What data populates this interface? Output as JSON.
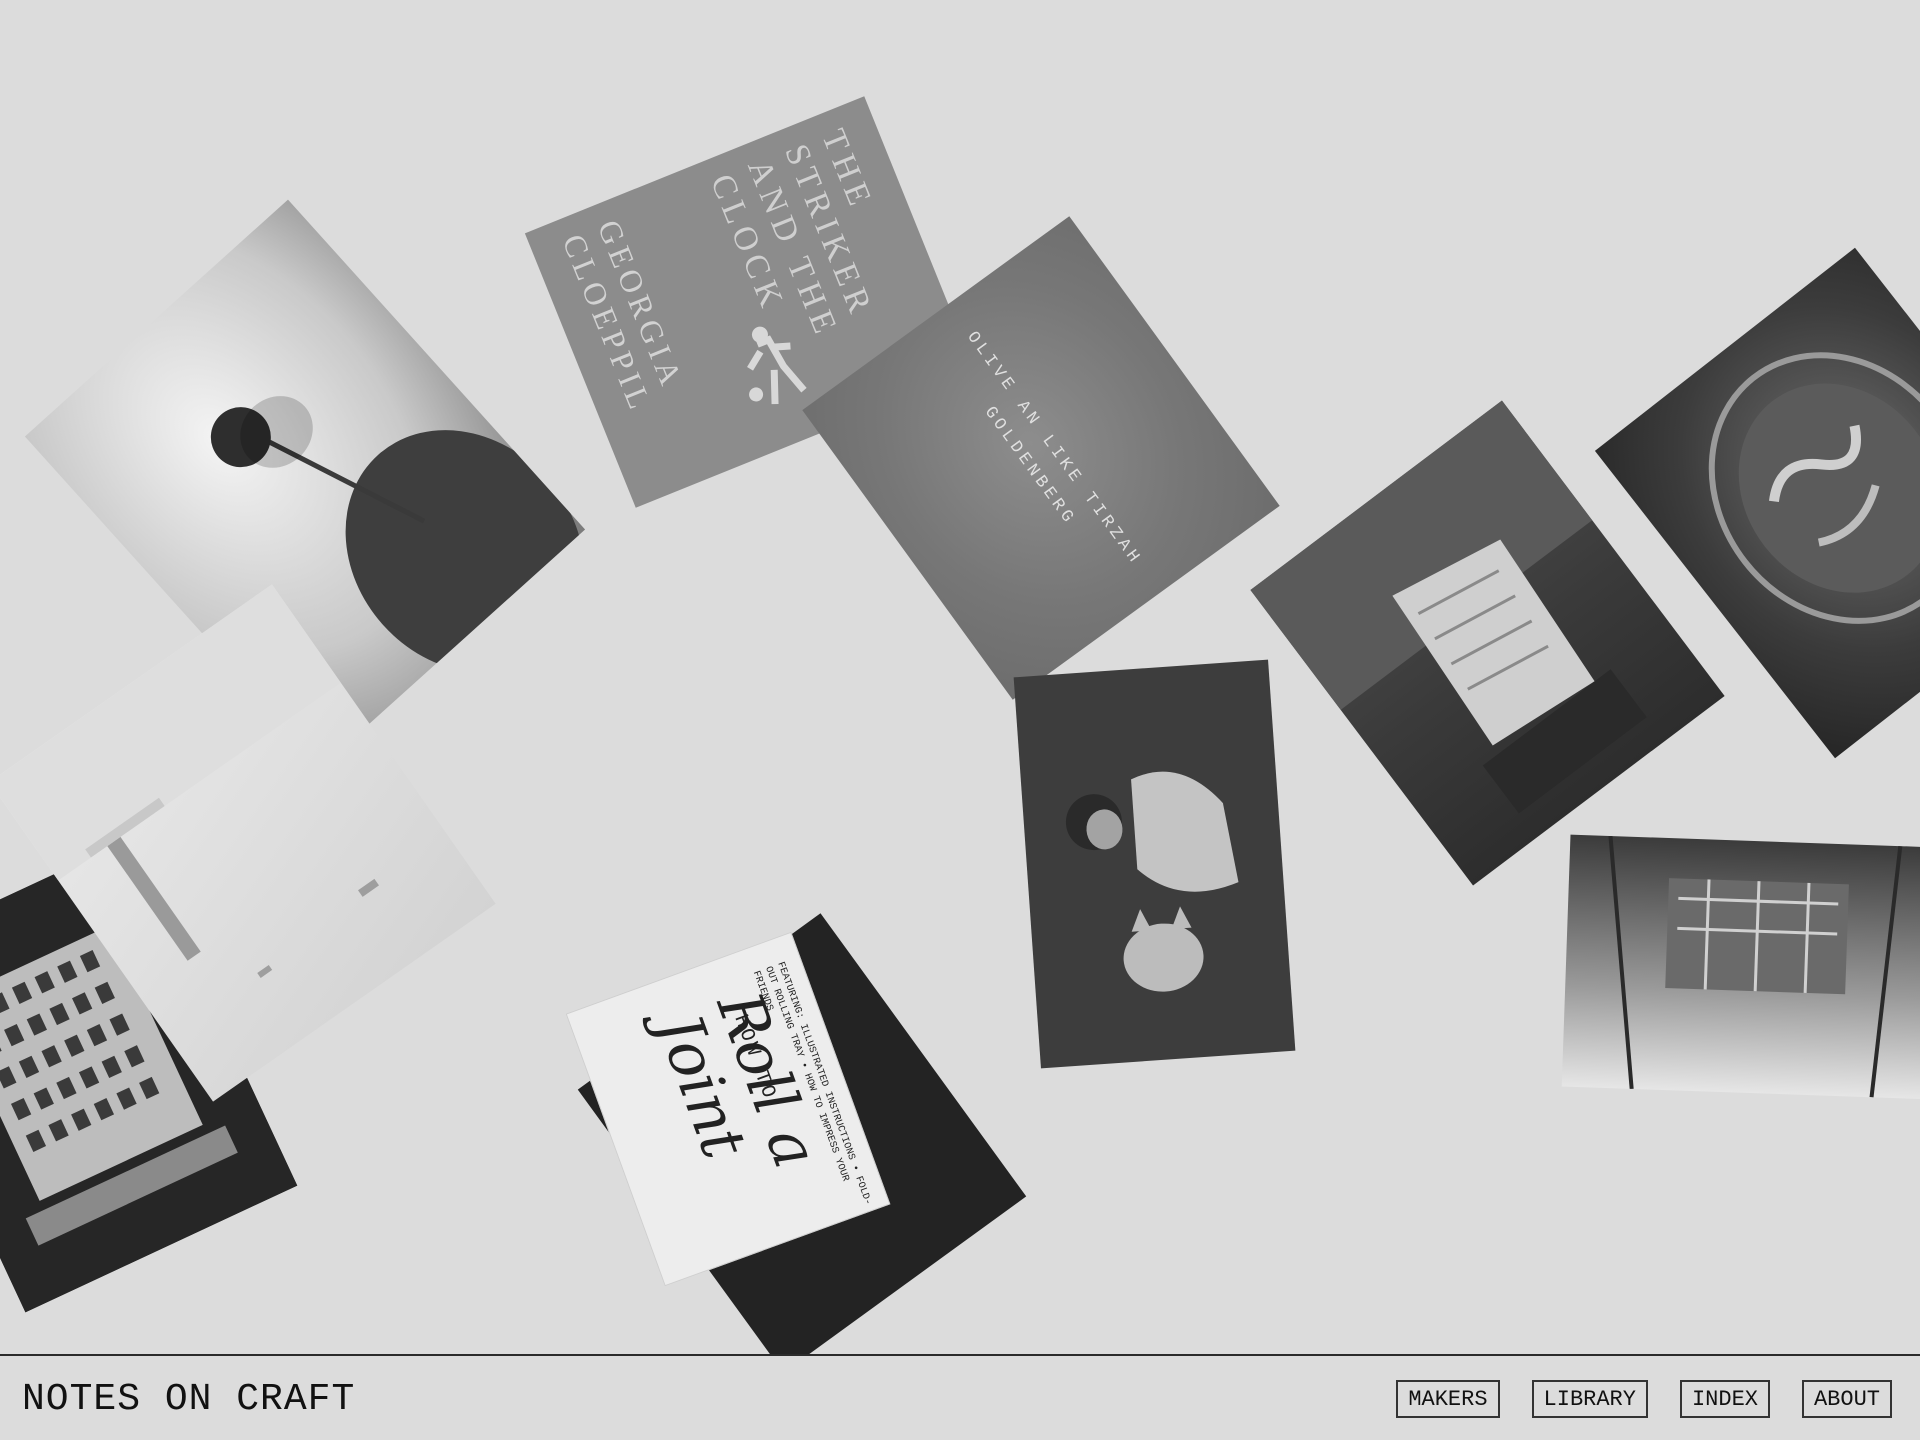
{
  "site": {
    "title": "NOTES ON CRAFT"
  },
  "nav": {
    "items": [
      {
        "label": "MAKERS"
      },
      {
        "label": "LIBRARY"
      },
      {
        "label": "INDEX"
      },
      {
        "label": "ABOUT"
      }
    ]
  },
  "cards": {
    "striker_book": {
      "title": "THE STRIKER AND THE CLOCK",
      "author": "GEORGIA CLOEPPIL"
    },
    "olive_book": {
      "text": "OLIVE AN LIKE TIRZAH GOLDENBERG"
    },
    "zine": {
      "how": "HOW TO",
      "title": "Roll a Joint",
      "list": "FEATURING: ILLUSTRATED INSTRUCTIONS • FOLD-OUT ROLLING TRAY • HOW TO IMPRESS YOUR FRIENDS"
    }
  },
  "colors": {
    "background": "#dcdcdc",
    "ink": "#111111"
  }
}
